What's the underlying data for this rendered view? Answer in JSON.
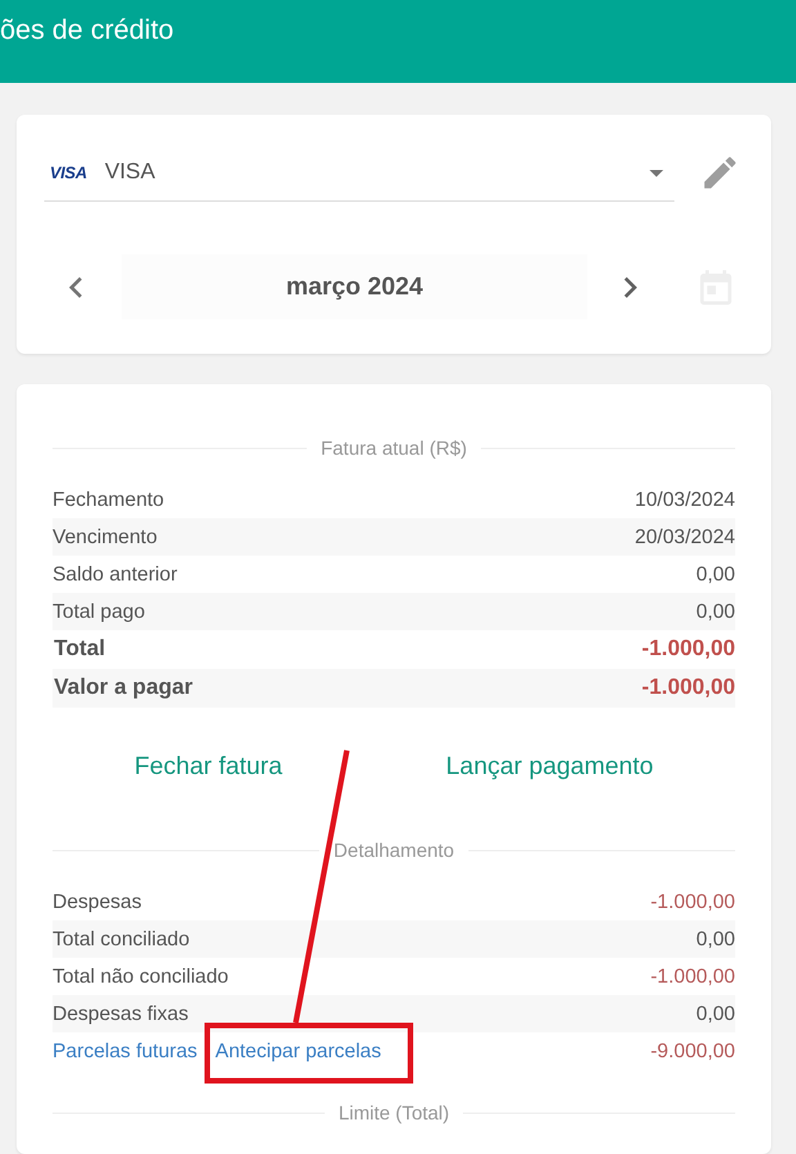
{
  "header": {
    "title": "ões de crédito"
  },
  "card_selector": {
    "brand": "VISA",
    "value": "VISA"
  },
  "month": {
    "label": "março 2024"
  },
  "calendar": {
    "disabled": true
  },
  "invoice": {
    "title": "Fatura atual (R$)",
    "rows": [
      {
        "label": "Fechamento",
        "value": "10/03/2024",
        "bold": false,
        "negative": false
      },
      {
        "label": "Vencimento",
        "value": "20/03/2024",
        "bold": false,
        "negative": false
      },
      {
        "label": "Saldo anterior",
        "value": "0,00",
        "bold": false,
        "negative": false
      },
      {
        "label": "Total pago",
        "value": "0,00",
        "bold": false,
        "negative": false
      },
      {
        "label": "Total",
        "value": "-1.000,00",
        "bold": true,
        "negative": true
      },
      {
        "label": "Valor a pagar",
        "value": "-1.000,00",
        "bold": true,
        "negative": true
      }
    ]
  },
  "actions": [
    "Fechar fatura",
    "Lançar pagamento"
  ],
  "detail": {
    "title": "Detalhamento",
    "rows": [
      {
        "label": "Despesas",
        "value": "-1.000,00",
        "negative": true
      },
      {
        "label": "Total conciliado",
        "value": "0,00",
        "negative": false
      },
      {
        "label": "Total não conciliado",
        "value": "-1.000,00",
        "negative": true
      },
      {
        "label": "Despesas fixas",
        "value": "0,00",
        "negative": false
      }
    ],
    "installments": {
      "links": [
        "Parcelas futuras",
        "Antecipar parcelas"
      ],
      "value": "-9.000,00",
      "negative": true
    }
  },
  "limit": {
    "title": "Limite (Total)"
  },
  "annotation": {
    "kind": "callout"
  }
}
